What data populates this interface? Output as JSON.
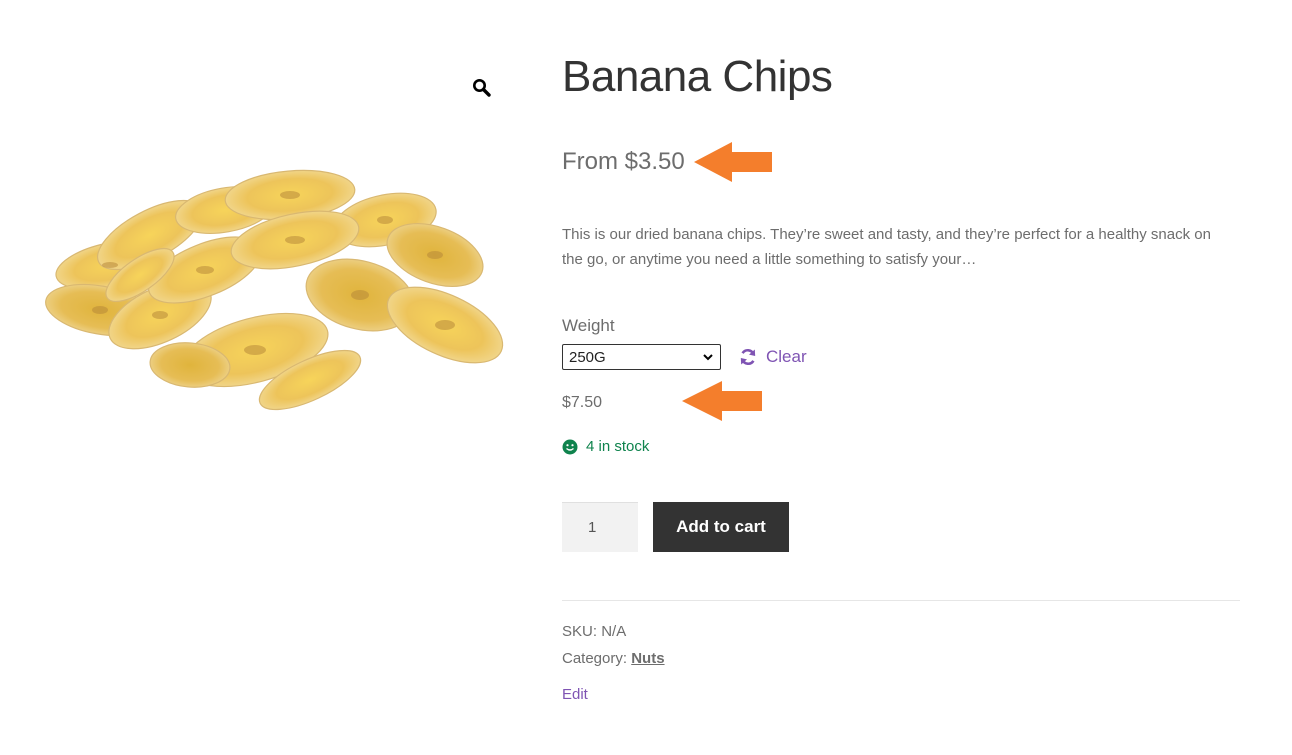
{
  "product": {
    "title": "Banana Chips",
    "price_range": "From $3.50",
    "description": "This is our dried banana chips. They’re sweet and tasty, and they’re perfect for a healthy snack on the go, or anytime you need a little something to satisfy your…",
    "image_icon": "product-photo-banana-chips",
    "zoom_icon": "magnifier-icon"
  },
  "variation": {
    "attribute_label": "Weight",
    "selected": "250G",
    "clear_label": "Clear",
    "clear_icon": "refresh-icon",
    "price": "$7.50",
    "stock_text": "4 in stock",
    "stock_icon": "smiley-icon"
  },
  "cart": {
    "quantity": "1",
    "button_label": "Add to cart"
  },
  "meta": {
    "sku_label": "SKU:",
    "sku_value": "N/A",
    "category_label": "Category:",
    "category_value": "Nuts"
  },
  "admin": {
    "edit_label": "Edit"
  },
  "annotations": {
    "arrow_color": "#f47e2c",
    "arrow_icon": "left-arrow-icon"
  },
  "colors": {
    "accent": "#7f54b3",
    "button_bg": "#333333",
    "stock": "#0f834d",
    "text": "#6d6d6d"
  }
}
